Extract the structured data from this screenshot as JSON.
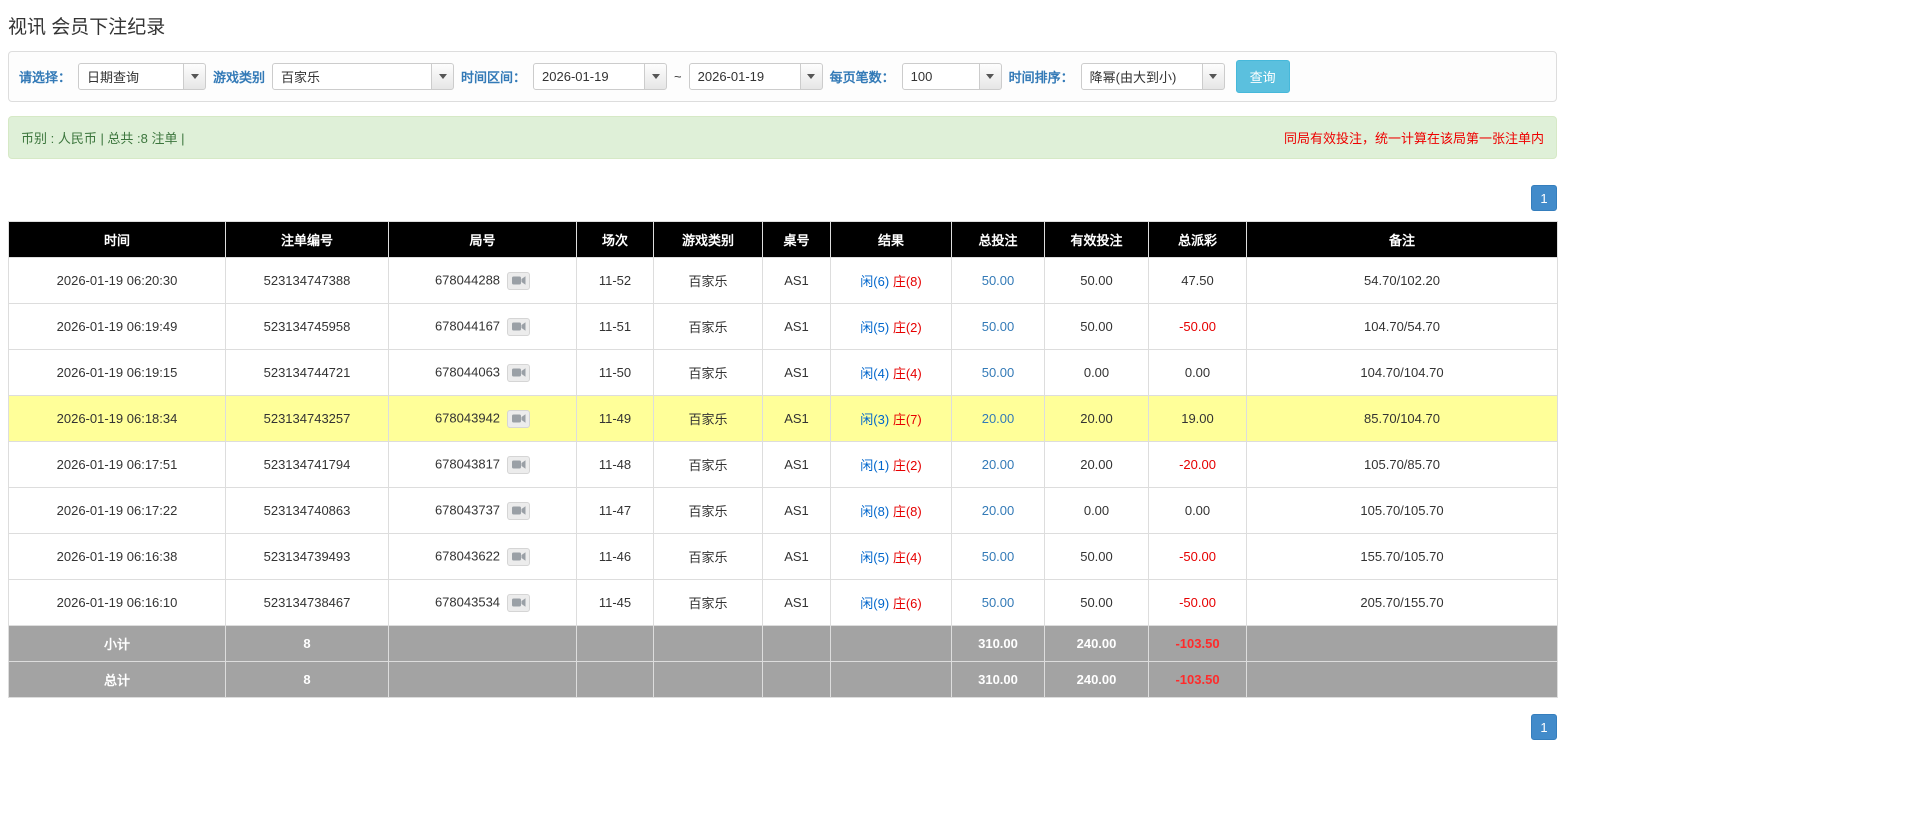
{
  "page": {
    "title": "视讯 会员下注纪录"
  },
  "filters": {
    "select_label": "请选择：",
    "select_value": "日期查询",
    "game_label": "游戏类别",
    "game_value": "百家乐",
    "range_label": "时间区间：",
    "date_from": "2026-01-19",
    "range_separator": "~",
    "date_to": "2026-01-19",
    "page_size_label": "每页笔数：",
    "page_size_value": "100",
    "sort_label": "时间排序：",
    "sort_value": "降幂(由大到小)",
    "search_button": "查询"
  },
  "summary": {
    "left": "币别 : 人民币 | 总共 :8 注单 |",
    "right": "同局有效投注，统一计算在该局第一张注单内"
  },
  "pagination": {
    "page": "1"
  },
  "icons": {
    "round_detail": "video-icon",
    "dropdown": "chevron-down-icon"
  },
  "colors": {
    "accent_blue": "#337ab7",
    "search_button": "#5bc0de",
    "pagination": "#428bca",
    "header_bg": "#000000",
    "highlight_row": "#ffff99",
    "footer_bg": "#a3a3a3",
    "negative": "#e60000",
    "player": "#0066cc",
    "banker": "#e60000",
    "summary_bg": "#dff0d8",
    "warning_text": "#ee0000"
  },
  "table": {
    "headers": [
      "时间",
      "注单编号",
      "局号",
      "场次",
      "游戏类别",
      "桌号",
      "结果",
      "总投注",
      "有效投注",
      "总派彩",
      "备注"
    ],
    "rows": [
      {
        "time": "2026-01-19 06:20:30",
        "bet_id": "523134747388",
        "round": "678044288",
        "session": "11-52",
        "game": "百家乐",
        "table_no": "AS1",
        "result_player": "闲(6)",
        "result_banker": "庄(8)",
        "total_bet": "50.00",
        "valid_bet": "50.00",
        "payout": "47.50",
        "remark": "54.70/102.20",
        "highlighted": false
      },
      {
        "time": "2026-01-19 06:19:49",
        "bet_id": "523134745958",
        "round": "678044167",
        "session": "11-51",
        "game": "百家乐",
        "table_no": "AS1",
        "result_player": "闲(5)",
        "result_banker": "庄(2)",
        "total_bet": "50.00",
        "valid_bet": "50.00",
        "payout": "-50.00",
        "remark": "104.70/54.70",
        "highlighted": false
      },
      {
        "time": "2026-01-19 06:19:15",
        "bet_id": "523134744721",
        "round": "678044063",
        "session": "11-50",
        "game": "百家乐",
        "table_no": "AS1",
        "result_player": "闲(4)",
        "result_banker": "庄(4)",
        "total_bet": "50.00",
        "valid_bet": "0.00",
        "payout": "0.00",
        "remark": "104.70/104.70",
        "highlighted": false
      },
      {
        "time": "2026-01-19 06:18:34",
        "bet_id": "523134743257",
        "round": "678043942",
        "session": "11-49",
        "game": "百家乐",
        "table_no": "AS1",
        "result_player": "闲(3)",
        "result_banker": "庄(7)",
        "total_bet": "20.00",
        "valid_bet": "20.00",
        "payout": "19.00",
        "remark": "85.70/104.70",
        "highlighted": true
      },
      {
        "time": "2026-01-19 06:17:51",
        "bet_id": "523134741794",
        "round": "678043817",
        "session": "11-48",
        "game": "百家乐",
        "table_no": "AS1",
        "result_player": "闲(1)",
        "result_banker": "庄(2)",
        "total_bet": "20.00",
        "valid_bet": "20.00",
        "payout": "-20.00",
        "remark": "105.70/85.70",
        "highlighted": false
      },
      {
        "time": "2026-01-19 06:17:22",
        "bet_id": "523134740863",
        "round": "678043737",
        "session": "11-47",
        "game": "百家乐",
        "table_no": "AS1",
        "result_player": "闲(8)",
        "result_banker": "庄(8)",
        "total_bet": "20.00",
        "valid_bet": "0.00",
        "payout": "0.00",
        "remark": "105.70/105.70",
        "highlighted": false
      },
      {
        "time": "2026-01-19 06:16:38",
        "bet_id": "523134739493",
        "round": "678043622",
        "session": "11-46",
        "game": "百家乐",
        "table_no": "AS1",
        "result_player": "闲(5)",
        "result_banker": "庄(4)",
        "total_bet": "50.00",
        "valid_bet": "50.00",
        "payout": "-50.00",
        "remark": "155.70/105.70",
        "highlighted": false
      },
      {
        "time": "2026-01-19 06:16:10",
        "bet_id": "523134738467",
        "round": "678043534",
        "session": "11-45",
        "game": "百家乐",
        "table_no": "AS1",
        "result_player": "闲(9)",
        "result_banker": "庄(6)",
        "total_bet": "50.00",
        "valid_bet": "50.00",
        "payout": "-50.00",
        "remark": "205.70/155.70",
        "highlighted": false
      }
    ],
    "footer": [
      {
        "label": "小计",
        "count": "8",
        "total_bet": "310.00",
        "valid_bet": "240.00",
        "payout": "-103.50"
      },
      {
        "label": "总计",
        "count": "8",
        "total_bet": "310.00",
        "valid_bet": "240.00",
        "payout": "-103.50"
      }
    ]
  }
}
